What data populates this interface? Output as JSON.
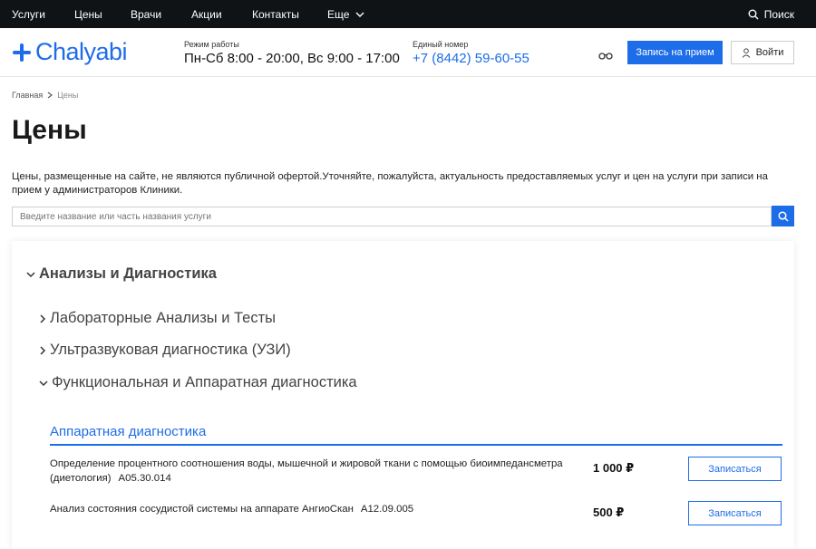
{
  "topnav": {
    "items": [
      "Услуги",
      "Цены",
      "Врачи",
      "Акции",
      "Контакты",
      "Еще"
    ],
    "search_label": "Поиск"
  },
  "header": {
    "logo_text": "Chalyabi",
    "hours_label": "Режим работы",
    "hours_value": "Пн-Сб 8:00 - 20:00, Вс 9:00 - 17:00",
    "phone_label": "Единый номер",
    "phone_value": "+7 (8442) 59-60-55",
    "book_label": "Запись на прием",
    "login_label": "Войти"
  },
  "breadcrumb": {
    "home": "Главная",
    "current": "Цены"
  },
  "page": {
    "title": "Цены",
    "disclaimer": "Цены, размещенные на сайте, не являются публичной офертой.Уточняйте, пожалуйста, актуальность предоставляемых услуг и цен на услуги при записи на прием у администраторов Клиники.",
    "search_placeholder": "Введите название или часть названия услуги"
  },
  "categories": {
    "main": "Анализы и Диагностика",
    "subs": [
      "Лабораторные Анализы и Тесты",
      "Ультразвуковая диагностика (УЗИ)",
      "Функциональная и Аппаратная диагностика"
    ]
  },
  "section": {
    "title": "Аппаратная диагностика",
    "rows": [
      {
        "name": "Определение процентного соотношения воды, мышечной и жировой ткани с помощью биоимпедансметра (диетология)",
        "code": "A05.30.014",
        "price": "1 000 ₽",
        "button": "Записаться"
      },
      {
        "name": "Анализ состояния сосудистой системы на аппарате АнгиоСкан",
        "code": "A12.09.005",
        "price": "500 ₽",
        "button": "Записаться"
      }
    ]
  },
  "colors": {
    "accent": "#1e6de8",
    "topbar": "#0f1316"
  }
}
